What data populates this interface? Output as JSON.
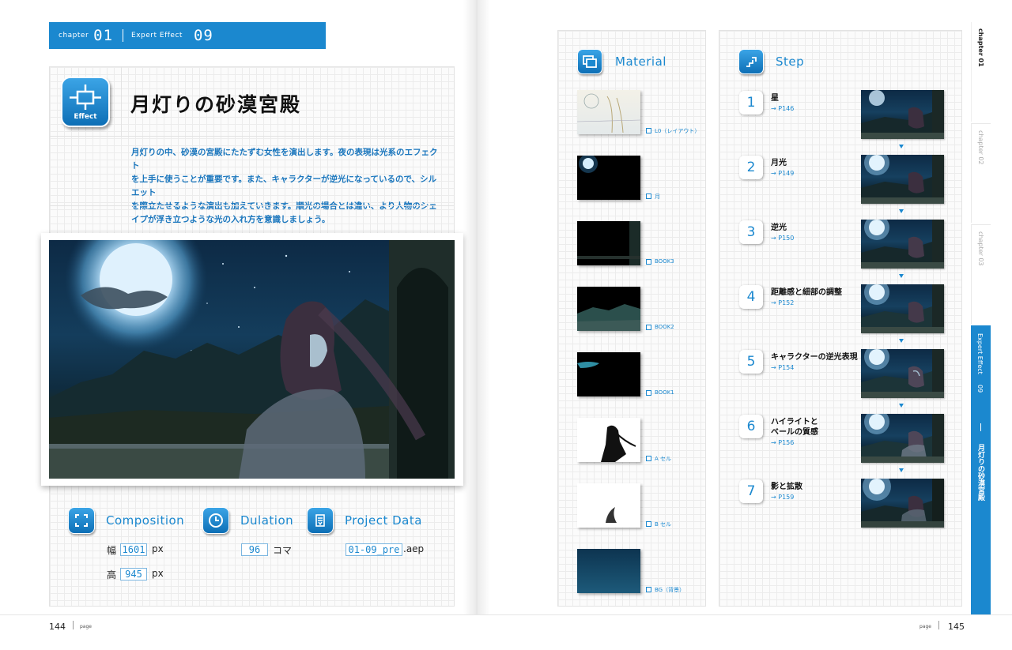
{
  "chapter_bar": {
    "chapter_label": "chapter",
    "chapter_num": "01",
    "section_label": "Expert Effect",
    "section_num": "09"
  },
  "title_block": {
    "icon_label": "Effect",
    "title": "月灯りの砂漠宮殿",
    "description": [
      "月灯りの中、砂漠の宮殿にたたずむ女性を演出します。夜の表現は光系のエフェクト",
      "を上手に使うことが重要です。また、キャラクターが逆光になっているので、シルエット",
      "を際立たせるような演出も加えていきます。順光の場合とは違い、より人物のシェ",
      "イプが浮き立つような光の入れ方を意識しましょう。"
    ]
  },
  "info": {
    "composition": {
      "title": "Composition",
      "width_label": "幅",
      "width": "1601",
      "width_unit": "px",
      "height_label": "高",
      "height": "945",
      "height_unit": "px"
    },
    "duration": {
      "title": "Dulation",
      "value": "96",
      "unit": "コマ"
    },
    "project": {
      "title": "Project Data",
      "filename": "01-09_pre",
      "ext": ".aep"
    }
  },
  "material": {
    "title": "Material",
    "items": [
      {
        "label": "L0（レイアウト）"
      },
      {
        "label": "月"
      },
      {
        "label": "BOOK3"
      },
      {
        "label": "BOOK2"
      },
      {
        "label": "BOOK1"
      },
      {
        "label": "A セル"
      },
      {
        "label": "B セル"
      },
      {
        "label": "BG（背景）"
      }
    ]
  },
  "step": {
    "title": "Step",
    "items": [
      {
        "num": "1",
        "name": "星",
        "ref": "→ P146"
      },
      {
        "num": "2",
        "name": "月光",
        "ref": "→ P149"
      },
      {
        "num": "3",
        "name": "逆光",
        "ref": "→ P150"
      },
      {
        "num": "4",
        "name": "距離感と細部の調整",
        "ref": "→ P152"
      },
      {
        "num": "5",
        "name": "キャラクターの逆光表現",
        "ref": "→ P154"
      },
      {
        "num": "6",
        "name": "ハイライトと\nベールの質感",
        "ref": "→ P156"
      },
      {
        "num": "7",
        "name": "影と拡散",
        "ref": "→ P159"
      }
    ]
  },
  "side_tabs": {
    "ch01": "chapter 01",
    "ch02": "chapter 02",
    "ch03": "chapter 03",
    "active_section": "Expert Effect",
    "active_num": "09",
    "active_title": "月灯りの砂漠宮殿"
  },
  "folio": {
    "left_num": "144",
    "left_label": "page",
    "right_label": "page",
    "right_num": "145"
  },
  "colors": {
    "accent": "#1b88cf",
    "accent_dark": "#0d6fb6",
    "panel_border": "#e3e3e3"
  }
}
